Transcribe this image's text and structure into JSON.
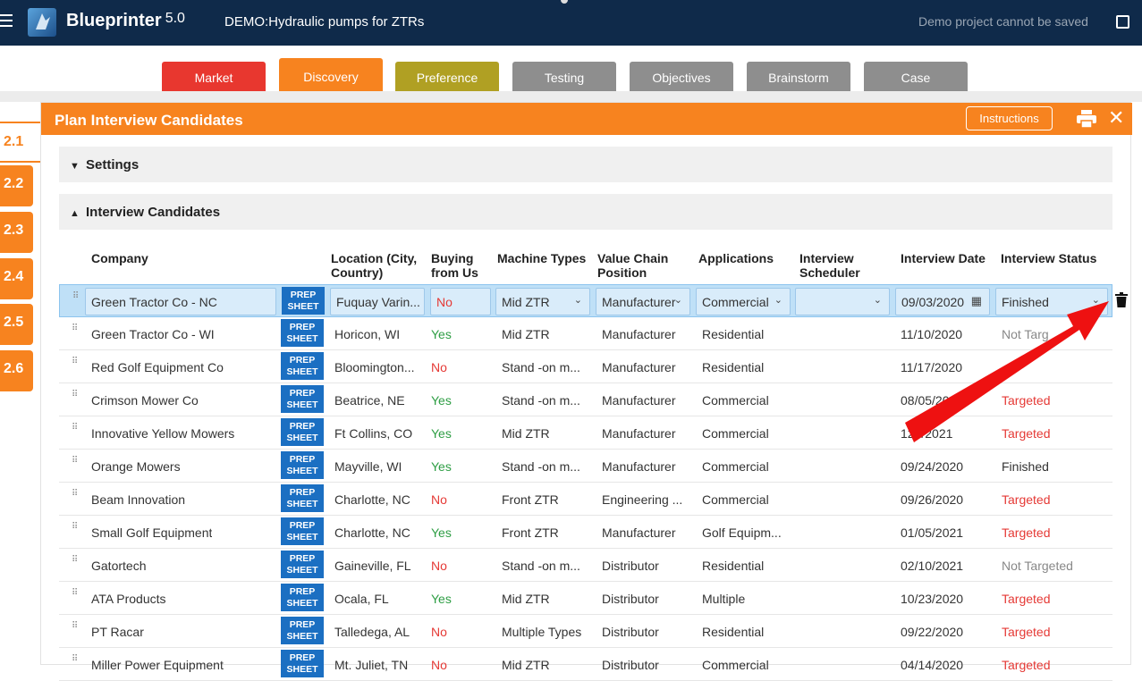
{
  "header": {
    "brand": "Blueprinter",
    "version": "5.0",
    "project": "DEMO:Hydraulic pumps for ZTRs",
    "notice": "Demo project cannot be saved"
  },
  "tabs": [
    {
      "label": "Market",
      "color": "#e8372f"
    },
    {
      "label": "Discovery",
      "color": "#f7831f"
    },
    {
      "label": "Preference",
      "color": "#b0a023"
    },
    {
      "label": "Testing",
      "color": "#8e8e8e"
    },
    {
      "label": "Objectives",
      "color": "#8e8e8e"
    },
    {
      "label": "Brainstorm",
      "color": "#8e8e8e"
    },
    {
      "label": "Case",
      "color": "#8e8e8e"
    }
  ],
  "steps": [
    "2.1",
    "2.2",
    "2.3",
    "2.4",
    "2.5",
    "2.6"
  ],
  "panel": {
    "title": "Plan Interview Candidates",
    "instructions_label": "Instructions",
    "sections": {
      "settings": "Settings",
      "candidates": "Interview Candidates"
    }
  },
  "columns": {
    "company": "Company",
    "location": "Location (City, Country)",
    "buying": "Buying from Us",
    "machine": "Machine Types",
    "value_chain": "Value Chain Position",
    "applications": "Applications",
    "scheduler": "Interview Scheduler",
    "date": "Interview Date",
    "status": "Interview Status"
  },
  "prep_label": "PREP SHEET",
  "rows": [
    {
      "company": "Green Tractor Co - NC",
      "location": "Fuquay Varin...",
      "buying": "No",
      "machine": "Mid ZTR",
      "value_chain": "Manufacturer",
      "applications": "Commercial",
      "scheduler": "",
      "date": "09/03/2020",
      "status": "Finished"
    },
    {
      "company": "Green Tractor Co - WI",
      "location": "Horicon, WI",
      "buying": "Yes",
      "machine": "Mid ZTR",
      "value_chain": "Manufacturer",
      "applications": "Residential",
      "scheduler": "",
      "date": "11/10/2020",
      "status": "Not Targ"
    },
    {
      "company": "Red Golf Equipment Co",
      "location": "Bloomington...",
      "buying": "No",
      "machine": "Stand -on m...",
      "value_chain": "Manufacturer",
      "applications": "Residential",
      "scheduler": "",
      "date": "11/17/2020",
      "status": ""
    },
    {
      "company": "Crimson Mower Co",
      "location": "Beatrice, NE",
      "buying": "Yes",
      "machine": "Stand -on m...",
      "value_chain": "Manufacturer",
      "applications": "Commercial",
      "scheduler": "",
      "date": "08/05/20",
      "status": "Targeted"
    },
    {
      "company": "Innovative Yellow Mowers",
      "location": "Ft Collins, CO",
      "buying": "Yes",
      "machine": "Mid ZTR",
      "value_chain": "Manufacturer",
      "applications": "Commercial",
      "scheduler": "",
      "date": "12/  /2021",
      "status": "Targeted"
    },
    {
      "company": "Orange Mowers",
      "location": "Mayville, WI",
      "buying": "Yes",
      "machine": "Stand -on m...",
      "value_chain": "Manufacturer",
      "applications": "Commercial",
      "scheduler": "",
      "date": "09/24/2020",
      "status": "Finished"
    },
    {
      "company": "Beam Innovation",
      "location": "Charlotte, NC",
      "buying": "No",
      "machine": "Front ZTR",
      "value_chain": "Engineering ...",
      "applications": "Commercial",
      "scheduler": "",
      "date": "09/26/2020",
      "status": "Targeted"
    },
    {
      "company": "Small Golf Equipment",
      "location": "Charlotte, NC",
      "buying": "Yes",
      "machine": "Front ZTR",
      "value_chain": "Manufacturer",
      "applications": "Golf Equipm...",
      "scheduler": "",
      "date": "01/05/2021",
      "status": "Targeted"
    },
    {
      "company": "Gatortech",
      "location": "Gaineville, FL",
      "buying": "No",
      "machine": "Stand -on m...",
      "value_chain": "Distributor",
      "applications": "Residential",
      "scheduler": "",
      "date": "02/10/2021",
      "status": "Not Targeted"
    },
    {
      "company": "ATA Products",
      "location": "Ocala, FL",
      "buying": "Yes",
      "machine": "Mid ZTR",
      "value_chain": "Distributor",
      "applications": "Multiple",
      "scheduler": "",
      "date": "10/23/2020",
      "status": "Targeted"
    },
    {
      "company": "PT Racar",
      "location": "Talledega, AL",
      "buying": "No",
      "machine": "Multiple Types",
      "value_chain": "Distributor",
      "applications": "Residential",
      "scheduler": "",
      "date": "09/22/2020",
      "status": "Targeted"
    },
    {
      "company": "Miller Power Equipment",
      "location": "Mt. Juliet, TN",
      "buying": "No",
      "machine": "Mid ZTR",
      "value_chain": "Distributor",
      "applications": "Commercial",
      "scheduler": "",
      "date": "04/14/2020",
      "status": "Targeted"
    }
  ],
  "colors": {
    "accent": "#f7831f",
    "navy": "#0f2a4a",
    "prep": "#1b6fc2",
    "selected_row": "#bfe0f7",
    "arrow": "#ee1111"
  },
  "icons": [
    "menu-icon",
    "logo-icon",
    "exit-icon",
    "print-icon",
    "close-icon",
    "calendar-icon",
    "trash-icon",
    "chevron-down-icon",
    "chevron-up-icon",
    "drag-handle-icon",
    "pointer-arrow"
  ]
}
